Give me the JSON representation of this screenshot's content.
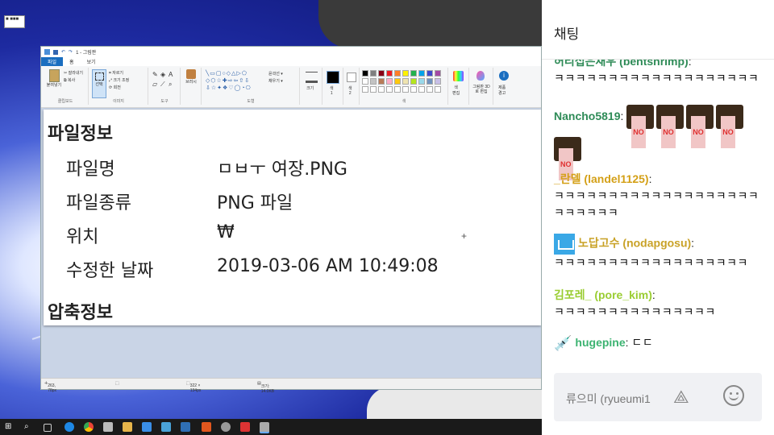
{
  "desktop": {
    "icon_label": "■ ■■■"
  },
  "paint": {
    "title": "1 - 그림판",
    "tabs": [
      "파일",
      "홈",
      "보기"
    ],
    "ribbon": {
      "paste": "붙여넣기",
      "cut": "잘라내기",
      "copy": "복사",
      "select": "선택",
      "crop": "자르기",
      "resize": "크기 조정",
      "rotate": "회전",
      "brush": "브러시",
      "outline": "윤곽선",
      "fill": "채우기",
      "size": "크기",
      "color1": "색\n1",
      "color2": "색\n2",
      "edit_colors": "색\n편집",
      "paint3d": "그림판 3D로 편집",
      "product_alert": "제품\n경고",
      "groups": {
        "clipboard": "클립보드",
        "image": "이미지",
        "tools": "도구",
        "shapes": "도형",
        "colors": "색"
      }
    },
    "document": {
      "heading_file_info": "파일정보",
      "rows": [
        {
          "label": "파일명",
          "value": "ㅁㅂㅜ 여장.PNG"
        },
        {
          "label": "파일종류",
          "value": "PNG 파일"
        },
        {
          "label": "위치",
          "value": "₩"
        },
        {
          "label": "수정한 날짜",
          "value": "2019-03-06 AM 10:49:08"
        }
      ],
      "heading_zip_info": "압축정보"
    },
    "status": {
      "cursor": "263, 78px",
      "selection": "",
      "image_size": "322 × 134px",
      "file_size": "크기: 14.0KB"
    }
  },
  "chat": {
    "title": "채팅",
    "messages": [
      {
        "user": "허리접은새우 (bentshrimp)",
        "color": "#2e8b57",
        "text": "ㅋㅋㅋㅋㅋㅋㅋㅋㅋㅋㅋㅋㅋㅋㅋㅋㅋㅋㅋ"
      },
      {
        "user": "Nancho5819",
        "color": "#2e8b57",
        "emotes": 5
      },
      {
        "user": "_란델 (landel1125)",
        "color": "#d4a017",
        "text": "ㅋㅋㅋㅋㅋㅋㅋㅋㅋㅋㅋㅋㅋㅋㅋㅋㅋㅋㅋㅋㅋㅋㅋㅋㅋ"
      },
      {
        "user": "노답고수 (nodapgosu)",
        "color": "#c9a227",
        "text": "ㅋㅋㅋㅋㅋㅋㅋㅋㅋㅋㅋㅋㅋㅋㅋㅋㅋㅋ"
      },
      {
        "user": "김포레_ (pore_kim)",
        "color": "#9acd32",
        "text": "ㅋㅋㅋㅋㅋㅋㅋㅋㅋㅋㅋㅋㅋㅋㅋ"
      },
      {
        "user": "hugepine",
        "color": "#3cb371",
        "text": "ㄷㄷ"
      }
    ],
    "input_placeholder": "류으미 (ryueumi1"
  },
  "colors": {
    "paint_file_tab": "#1a6ec0",
    "chat_bg": "#ffffff",
    "taskbar": "#1a1a1a"
  }
}
